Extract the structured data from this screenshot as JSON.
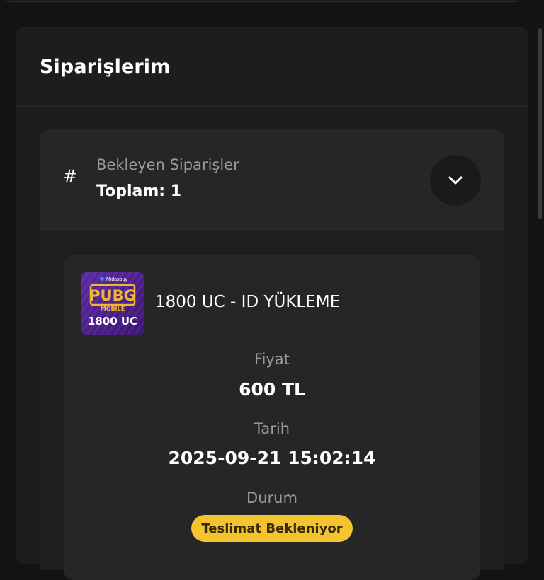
{
  "orders": {
    "title": "Siparişlerim"
  },
  "pending": {
    "hash_symbol": "#",
    "label": "Bekleyen Siparişler",
    "total": "Toplam: 1",
    "toggle_icon": "chevron-down-icon"
  },
  "order": {
    "thumbnail": {
      "brand": "Midasbuy",
      "game": "PUBG",
      "subtitle": "MOBILE",
      "amount": "1800 UC",
      "bg_color": "#4a1f8a"
    },
    "product_name": "1800 UC - ID YÜKLEME",
    "price_label": "Fiyat",
    "price_value": "600 TL",
    "date_label": "Tarih",
    "date_value": "2025-09-21 15:02:14",
    "status_label": "Durum",
    "status_value": "Teslimat Bekleniyor",
    "status_color": "#f4c430"
  }
}
